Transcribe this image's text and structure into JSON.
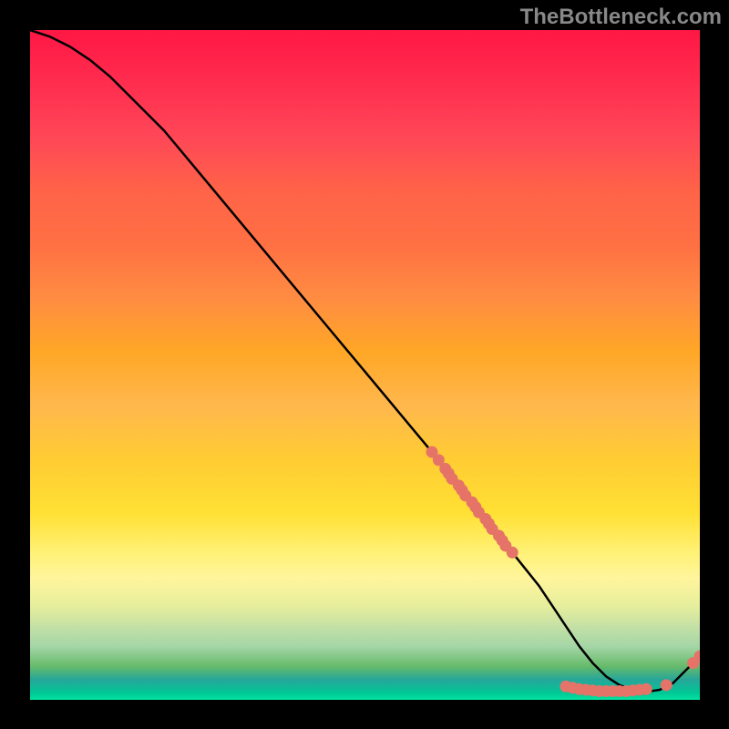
{
  "watermark": "TheBottleneck.com",
  "chart_data": {
    "type": "line",
    "title": "",
    "xlabel": "",
    "ylabel": "",
    "xlim": [
      0,
      100
    ],
    "ylim": [
      0,
      100
    ],
    "curve": {
      "x": [
        0,
        3,
        6,
        9,
        12,
        15,
        20,
        25,
        30,
        35,
        40,
        45,
        50,
        55,
        60,
        62,
        64,
        66,
        68,
        70,
        72,
        74,
        76,
        78,
        80,
        82,
        84,
        86,
        88,
        90,
        92,
        94,
        96,
        98,
        99,
        100
      ],
      "y": [
        100,
        99,
        97.5,
        95.5,
        93,
        90,
        85,
        79,
        73,
        67,
        61,
        55,
        49,
        43,
        37,
        34.5,
        32,
        29.5,
        27,
        24.5,
        22,
        19.5,
        17,
        14,
        11,
        8,
        5.5,
        3.5,
        2.2,
        1.5,
        1.2,
        1.5,
        2.5,
        4.5,
        5.5,
        6.5
      ]
    },
    "markers": {
      "segment1": {
        "x": [
          60,
          61,
          62,
          62.5,
          63,
          64,
          64.5,
          65,
          66,
          66.5,
          67,
          68,
          68.5,
          69,
          70,
          70.5,
          71,
          72
        ],
        "y": [
          37,
          35.8,
          34.5,
          33.8,
          33,
          32,
          31.3,
          30.5,
          29.5,
          28.8,
          28,
          27,
          26.3,
          25.5,
          24.5,
          23.8,
          23,
          22
        ]
      },
      "segment2": {
        "x": [
          80,
          81,
          82,
          83,
          84,
          85,
          86,
          87,
          88,
          89,
          90,
          91,
          92,
          95
        ],
        "y": [
          2.0,
          1.8,
          1.6,
          1.5,
          1.4,
          1.3,
          1.3,
          1.3,
          1.3,
          1.3,
          1.4,
          1.5,
          1.6,
          2.2
        ]
      },
      "segment3": {
        "x": [
          99,
          100
        ],
        "y": [
          5.5,
          6.5
        ]
      }
    },
    "colors": {
      "curve": "#000000",
      "marker": "#e57368",
      "background_top": "#ff1744",
      "background_bottom": "#00e5a0"
    }
  }
}
